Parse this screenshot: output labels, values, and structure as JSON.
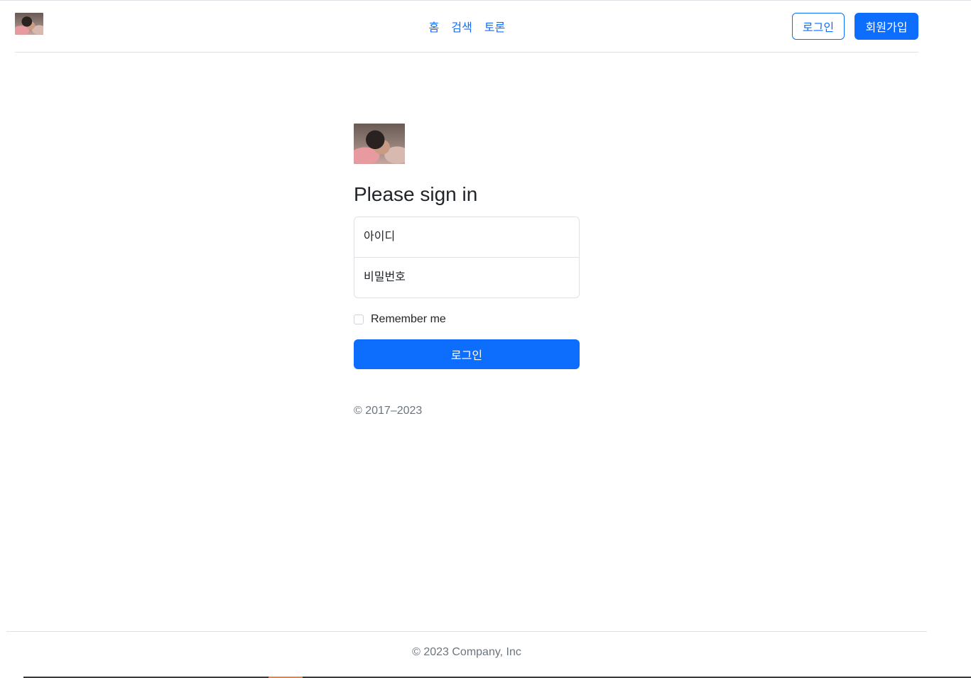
{
  "header": {
    "logo_icon": "profile-photo-thumbnail",
    "nav": [
      "홈",
      "검색",
      "토론"
    ],
    "login_label": "로그인",
    "signup_label": "회원가입"
  },
  "form": {
    "logo_icon": "profile-photo-thumbnail",
    "heading": "Please sign in",
    "username_placeholder": "아이디",
    "password_placeholder": "비밀번호",
    "remember_label": "Remember me",
    "remember_checked": false,
    "submit_label": "로그인",
    "copyright": "© 2017–2023"
  },
  "footer": {
    "text": "© 2023 Company, Inc"
  },
  "colors": {
    "primary": "#0d6efd",
    "muted": "#6c757d",
    "border": "#dee2e6"
  }
}
